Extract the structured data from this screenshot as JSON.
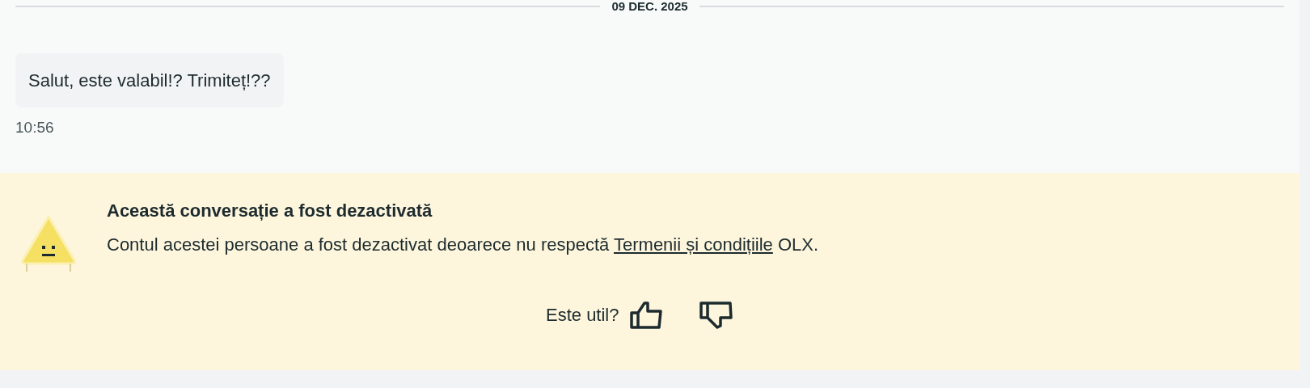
{
  "date_separator": "09 DEC. 2025",
  "messages": [
    {
      "text": "Salut, este valabil!? Trimiteț!??",
      "time": "10:56"
    }
  ],
  "notice": {
    "title": "Această conversație a fost dezactivată",
    "text_before": "Contul acestei persoane a fost dezactivat deoarece nu respectă",
    "link": "Termenii și condițiile",
    "text_after": "OLX.",
    "feedback": {
      "question": "Este util?"
    }
  }
}
